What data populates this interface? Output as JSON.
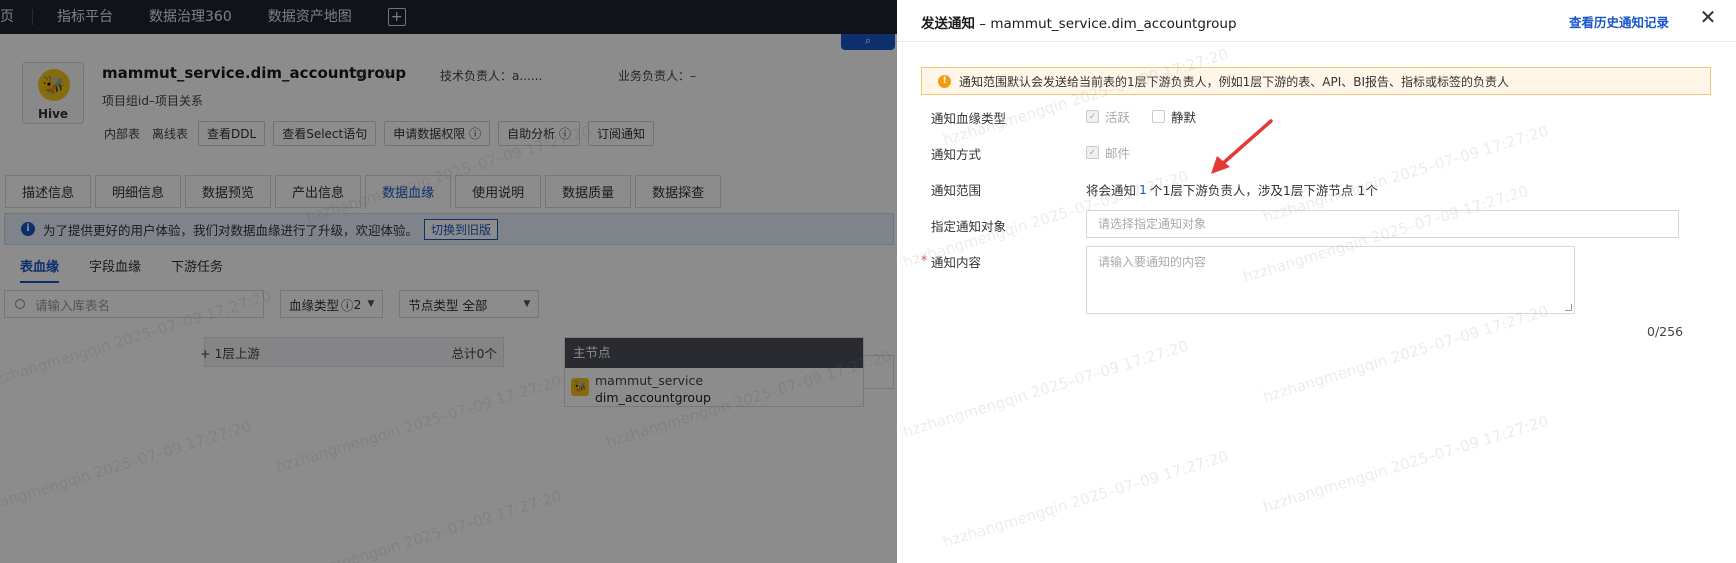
{
  "topnav": {
    "first_item": "页",
    "items": [
      "指标平台",
      "数据治理360",
      "数据资产地图"
    ],
    "add_symbol": "+"
  },
  "table_header": {
    "title": "mammut_service.dim_accountgroup",
    "logo_label": "Hive",
    "tech_owner_label": "技术负责人：",
    "tech_owner_value": "a...... ",
    "biz_owner_label": "业务负责人：",
    "biz_owner_value": "–",
    "subtitle": "项目组id–项目关系",
    "tags": [
      "内部表",
      "离线表"
    ],
    "buttons": [
      "查看DDL",
      "查看Select语句",
      "申请数据权限",
      "自助分析",
      "订阅通知"
    ]
  },
  "tabs": [
    "描述信息",
    "明细信息",
    "数据预览",
    "产出信息",
    "数据血缘",
    "使用说明",
    "数据质量",
    "数据探查"
  ],
  "active_tab": "数据血缘",
  "info_bar": {
    "text": "为了提供更好的用户体验，我们对数据血缘进行了升级，欢迎体验。",
    "switch_button": "切换到旧版"
  },
  "subtabs": [
    "表血缘",
    "字段血缘",
    "下游任务"
  ],
  "filters": {
    "search_placeholder": "请输入库表名",
    "lineage_type_label": "血缘类型",
    "lineage_type_value": "2",
    "node_type_label": "节点类型",
    "node_type_value": "全部"
  },
  "graph": {
    "upstream_label": "1层上游",
    "upstream_total": "总计0个",
    "main_node_header": "主节点",
    "main_node_line1": "mammut_service",
    "main_node_line2": "dim_accountgroup"
  },
  "drawer": {
    "title": "发送通知",
    "title_sep": " – ",
    "title_table": "mammut_service.dim_accountgroup",
    "history_link": "查看历史通知记录",
    "warning": "通知范围默认会发送给当前表的1层下游负责人，例如1层下游的表、API、BI报告、指标或标签的负责人",
    "lineage_type_label": "通知血缘类型",
    "lineage_opt_active": "活跃",
    "lineage_opt_silent": "静默",
    "method_label": "通知方式",
    "method_email": "邮件",
    "scope_label": "通知范围",
    "scope_prefix": "将会通知",
    "scope_count": "1",
    "scope_middle": "个1层下游负责人，涉及1层下游节点",
    "scope_nodes": "1个",
    "target_label": "指定通知对象",
    "target_placeholder": "请选择指定通知对象",
    "content_label": "通知内容",
    "content_placeholder": "请输入要通知的内容",
    "counter": "0/256"
  },
  "watermark": "hzzhangmengqin 2025–07–09 17:27:20",
  "colors": {
    "accent": "#1a56c8",
    "warning_bg": "#fff6e8",
    "warning_border": "#f5c27a",
    "arrow": "#e53935",
    "topnav_bg": "#1f2430"
  }
}
